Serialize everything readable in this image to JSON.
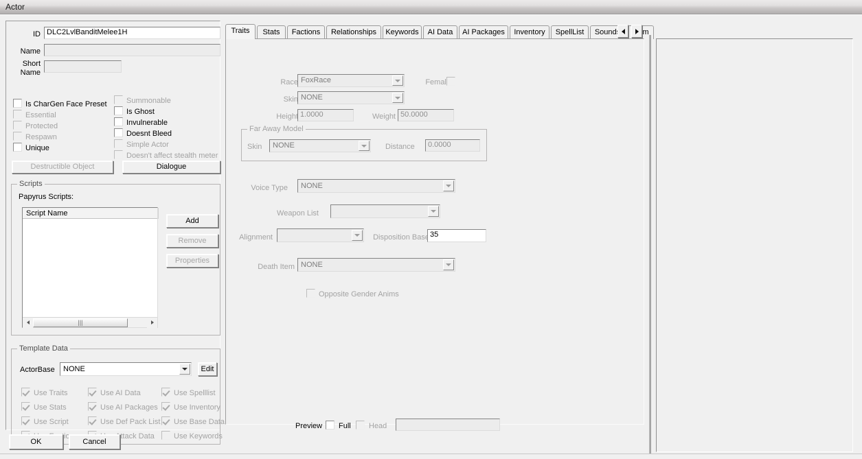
{
  "window": {
    "title": "Actor"
  },
  "form": {
    "id_label": "ID",
    "id_value": "DLC2LvlBanditMelee1H",
    "name_label": "Name",
    "name_value": "",
    "short_name_label_line1": "Short",
    "short_name_label_line2": "Name",
    "short_name_value": ""
  },
  "flags_left": [
    {
      "label": "Is CharGen Face Preset",
      "checked": false,
      "disabled": false
    },
    {
      "label": "Essential",
      "checked": false,
      "disabled": true
    },
    {
      "label": "Protected",
      "checked": false,
      "disabled": true
    },
    {
      "label": "Respawn",
      "checked": false,
      "disabled": true
    },
    {
      "label": "Unique",
      "checked": false,
      "disabled": false
    }
  ],
  "flags_right": [
    {
      "label": "Summonable",
      "checked": false,
      "disabled": true
    },
    {
      "label": "Is Ghost",
      "checked": false,
      "disabled": false
    },
    {
      "label": "Invulnerable",
      "checked": false,
      "disabled": false
    },
    {
      "label": "Doesnt Bleed",
      "checked": false,
      "disabled": false
    },
    {
      "label": "Simple Actor",
      "checked": false,
      "disabled": true
    },
    {
      "label": "Doesn't affect stealth meter",
      "checked": false,
      "disabled": true
    }
  ],
  "buttons": {
    "destructible_object": "Destructible Object",
    "dialogue": "Dialogue",
    "ok": "OK",
    "cancel": "Cancel",
    "edit": "Edit"
  },
  "scripts": {
    "group_title": "Scripts",
    "caption": "Papyrus Scripts:",
    "column_header": "Script Name",
    "rows": [],
    "add": "Add",
    "remove": "Remove",
    "properties": "Properties"
  },
  "template_data": {
    "group_title": "Template Data",
    "actorbase_label": "ActorBase",
    "actorbase_value": "NONE",
    "checkboxes": [
      {
        "label": "Use Traits",
        "checked": true,
        "disabled": true
      },
      {
        "label": "Use AI Data",
        "checked": true,
        "disabled": true
      },
      {
        "label": "Use Spelllist",
        "checked": true,
        "disabled": true
      },
      {
        "label": "Use Stats",
        "checked": true,
        "disabled": true
      },
      {
        "label": "Use AI Packages",
        "checked": true,
        "disabled": true
      },
      {
        "label": "Use Inventory",
        "checked": true,
        "disabled": true
      },
      {
        "label": "Use Script",
        "checked": true,
        "disabled": true
      },
      {
        "label": "Use Def Pack List",
        "checked": true,
        "disabled": true
      },
      {
        "label": "Use Base Data",
        "checked": true,
        "disabled": true
      },
      {
        "label": "Use Factions",
        "checked": true,
        "disabled": true
      },
      {
        "label": "Use Attack Data",
        "checked": true,
        "disabled": true
      },
      {
        "label": "Use Keywords",
        "checked": false,
        "disabled": true
      }
    ]
  },
  "tabs": {
    "items": [
      {
        "label": "Traits",
        "selected": true
      },
      {
        "label": "Stats",
        "selected": false
      },
      {
        "label": "Factions",
        "selected": false
      },
      {
        "label": "Relationships",
        "selected": false
      },
      {
        "label": "Keywords",
        "selected": false
      },
      {
        "label": "AI Data",
        "selected": false
      },
      {
        "label": "AI Packages",
        "selected": false
      },
      {
        "label": "Inventory",
        "selected": false
      },
      {
        "label": "SpellList",
        "selected": false
      },
      {
        "label": "Sounds",
        "selected": false
      },
      {
        "label": "Anim",
        "selected": false
      }
    ],
    "spin_left": "◄",
    "spin_right": "►"
  },
  "traits": {
    "race_label": "Race",
    "race_value": "FoxRace",
    "skin_label": "Skin",
    "skin_value": "NONE",
    "female_label": "Female",
    "female_checked": false,
    "height_label": "Height",
    "height_value": "1.0000",
    "weight_label": "Weight",
    "weight_value": "50.0000",
    "far_away_model": {
      "group_title": "Far Away Model",
      "skin_label": "Skin",
      "skin_value": "NONE",
      "distance_label": "Distance",
      "distance_value": "0.0000"
    },
    "voice_type_label": "Voice Type",
    "voice_type_value": "NONE",
    "weapon_list_label": "Weapon List",
    "weapon_list_value": "",
    "alignment_label": "Alignment",
    "alignment_value": "",
    "disposition_base_label": "Disposition Base",
    "disposition_base_value": "35",
    "death_item_label": "Death Item",
    "death_item_value": "NONE",
    "opposite_gender_anims_label": "Opposite Gender Anims",
    "opposite_gender_anims_checked": false
  },
  "preview": {
    "label": "Preview",
    "full_label": "Full",
    "full_checked": false,
    "head_label": "Head",
    "head_checked": false,
    "field_value": ""
  }
}
